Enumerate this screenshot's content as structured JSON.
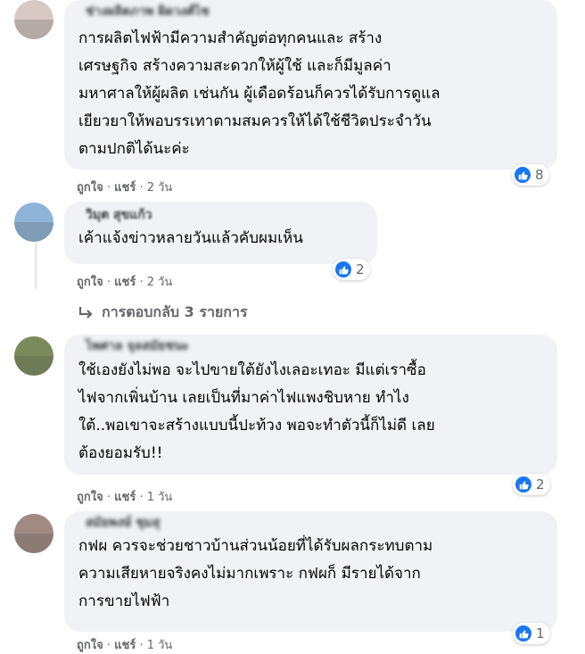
{
  "comments": [
    {
      "author": "ช่างผลิตภาพ ผิดวงศ์ไช",
      "text": "การผลิตไฟฟ้ามีความสำคัญต่อทุกคนและ สร้าง\nเศรษฐกิจ สร้างความสะดวกให้ผู้ใช้ และก็มีมูลค่า\nมหาศาลให้ผู้ผลิต เช่นกัน ผู้เดือดร้อนก็ควรได้รับการดูแล\nเยียวยาให้พอบรรเทาตามสมควรให้ได้ใช้ชีวิตประจำวัน\nตามปกติได้นะค่ะ",
      "like_count": "8",
      "like": "ถูกใจ",
      "share": "แชร์",
      "time": "2 วัน"
    },
    {
      "author": "วิมุต สุขแก้ว",
      "text": "เค้าแจ้งข่าวหลายวันแล้วคับผมเห็น",
      "like_count": "2",
      "like": "ถูกใจ",
      "share": "แชร์",
      "time": "2 วัน"
    },
    {
      "author": "ไพศาล จุลสมัยชนะ",
      "text": "ใช้เองยังไม่พอ จะไปขายใต้ยังไงเลอะเทอะ มีแต่เราซื้อ\nไฟจากเพิ่นบ้าน เลยเป็นที่มาค่าไฟแพงชิบหาย ทำไง\nใต้..พอเขาจะสร้างแบบนี้ปะท้วง พอจะทำตัวนี้ก็ไม่ดี เลย\nต้องยอมรับ!!",
      "like_count": "2",
      "like": "ถูกใจ",
      "share": "แชร์",
      "time": "1 วัน"
    },
    {
      "author": "สมัยพงษ์ ชุมสุ",
      "text": "กฟผ ควรจะช่วยชาวบ้านส่วนน้อยที่ได้รับผลกระทบตาม\nความเสียหายจริงคงไม่มากเพราะ กฟผก็ มีรายได้จาก\nการขายไฟฟ้า",
      "like_count": "1",
      "like": "ถูกใจ",
      "share": "แชร์",
      "time": "1 วัน"
    }
  ],
  "replies_link": "การตอบกลับ 3 รายการ",
  "colors": {
    "like_blue": "#1877f2",
    "bubble": "#f0f2f5",
    "meta": "#65676b"
  },
  "icons": {
    "like": "thumbs-up-icon",
    "reply_arrow": "reply-arrow-icon"
  }
}
